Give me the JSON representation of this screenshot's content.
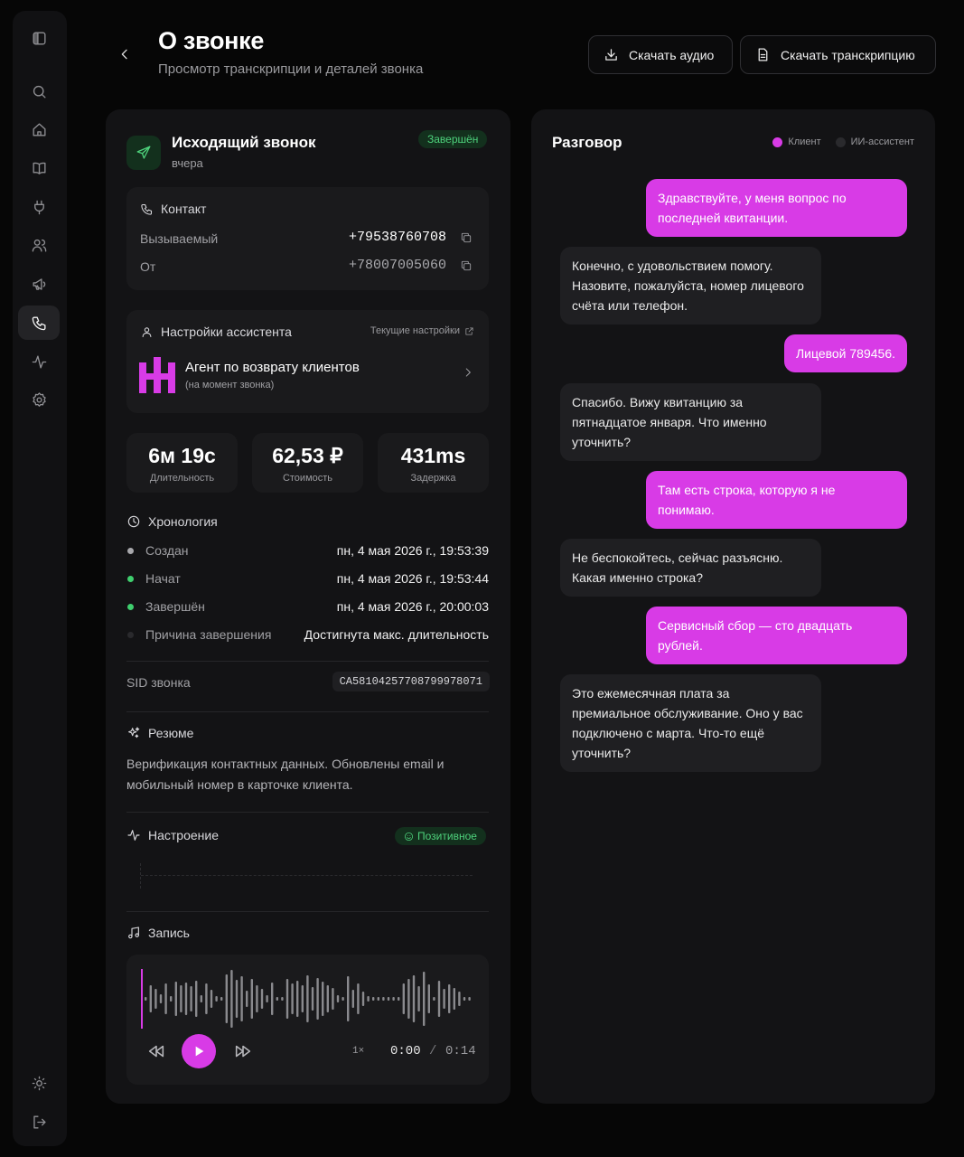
{
  "page": {
    "title": "О звонке",
    "subtitle": "Просмотр транскрипции и деталей звонка"
  },
  "actions": {
    "download_audio": "Скачать аудио",
    "download_transcript": "Скачать транскрипцию"
  },
  "call": {
    "title": "Исходящий звонок",
    "when": "вчера",
    "status": "Завершён",
    "contact": {
      "heading": "Контакт",
      "callee_label": "Вызываемый",
      "callee": "+79538760708",
      "from_label": "От",
      "from": "+78007005060"
    },
    "assistant": {
      "heading": "Настройки ассистента",
      "current_link": "Текущие настройки",
      "name": "Агент по возврату клиентов",
      "note": "(на момент звонка)"
    },
    "stats": [
      {
        "value": "6м 19с",
        "label": "Длительность"
      },
      {
        "value": "62,53 ₽",
        "label": "Стоимость"
      },
      {
        "value": "431ms",
        "label": "Задержка"
      }
    ],
    "timeline": {
      "heading": "Хронология",
      "rows": [
        {
          "label": "Создан",
          "value": "пн, 4 мая 2026 г., 19:53:39",
          "color": "#a8a8ac"
        },
        {
          "label": "Начат",
          "value": "пн, 4 мая 2026 г., 19:53:44",
          "color": "#3fcf6e"
        },
        {
          "label": "Завершён",
          "value": "пн, 4 мая 2026 г., 20:00:03",
          "color": "#3fcf6e"
        },
        {
          "label": "Причина завершения",
          "value": "Достигнута макс. длительность",
          "color": "#2a2a2d"
        }
      ]
    },
    "sid_label": "SID звонка",
    "sid": "CA5810425770879997807​1",
    "summary": {
      "heading": "Резюме",
      "text_1": "Верификация контактных данных. Обновлены email и",
      "text_2": "мобильный номер в карточке клиента."
    },
    "mood": {
      "heading": "Настроение",
      "value": "Позитивное"
    },
    "recording": {
      "heading": "Запись",
      "speed": "1×",
      "current": "0:00",
      "sep": "/",
      "total": "0:14",
      "progress": 0
    }
  },
  "conversation": {
    "title": "Разговор",
    "legend": [
      {
        "label": "Клиент",
        "color": "#d83be6"
      },
      {
        "label": "ИИ-ассистент",
        "color": "#2a2a2d"
      }
    ],
    "messages": [
      {
        "role": "client",
        "l1": "Здравствуйте, у меня вопрос по",
        "l2": "последней квитанции."
      },
      {
        "role": "agent",
        "l1": "Конечно, с удовольствием помогу.",
        "l2": "Назовите, пожалуйста, номер лицевого",
        "l3": "счёта или телефон."
      },
      {
        "role": "client",
        "l1": "Лицевой 789456."
      },
      {
        "role": "agent",
        "l1": "Спасибо. Вижу квитанцию за",
        "l2": "пятнадцатое января. Что именно",
        "l3": "уточнить?"
      },
      {
        "role": "client",
        "l1": "Там есть строка, которую я не",
        "l2": "понимаю."
      },
      {
        "role": "agent",
        "l1": "Не беспокойтесь, сейчас разъясню.",
        "l2": "Какая именно строка?"
      },
      {
        "role": "client",
        "l1": "Сервисный сбор — сто двадцать",
        "l2": "рублей."
      },
      {
        "role": "agent",
        "l1": "Это ежемесячная плата за",
        "l2": "премиальное обслуживание. Оно у вас",
        "l3": "подключено с марта. Что-то ещё",
        "l4": "уточнить?"
      }
    ]
  },
  "icons": {
    "sidebar": [
      "sidebar-toggle-icon",
      "search-icon",
      "home-icon",
      "book-icon",
      "plug-icon",
      "users-icon",
      "megaphone-icon",
      "phone-icon",
      "activity-icon",
      "settings-icon"
    ],
    "sidebar_bottom": [
      "theme-sun-icon",
      "logout-icon"
    ]
  }
}
